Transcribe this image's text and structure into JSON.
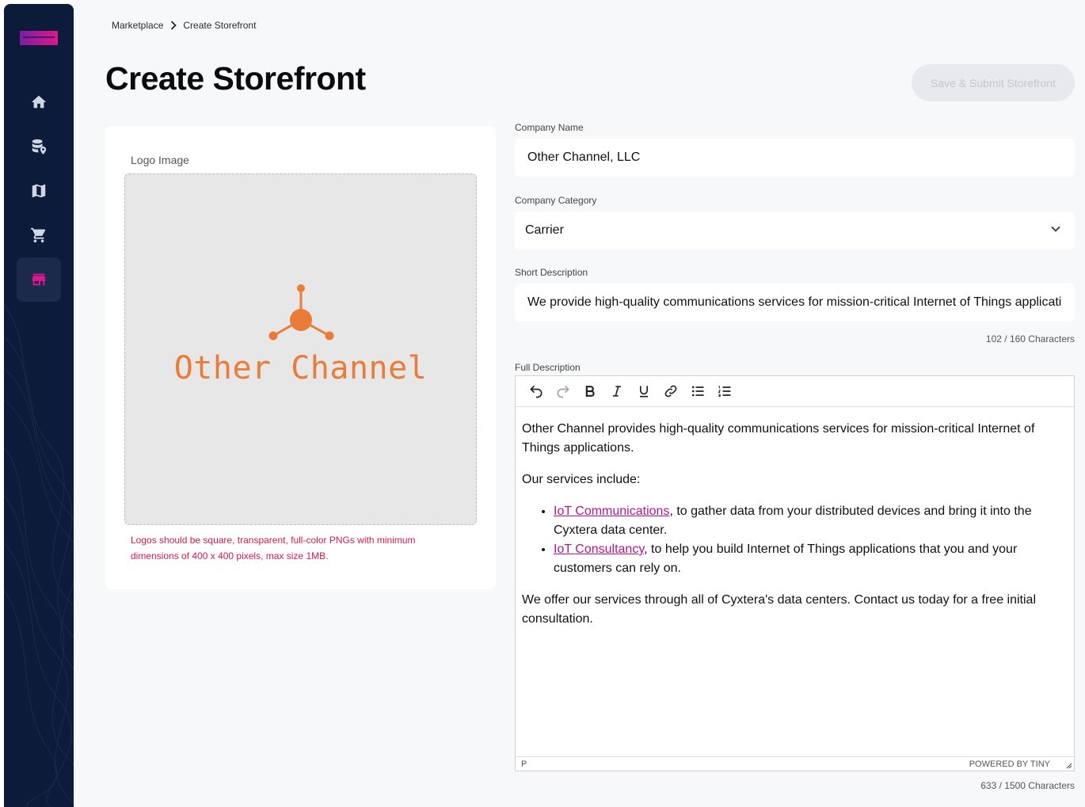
{
  "breadcrumb": {
    "parent": "Marketplace",
    "current": "Create Storefront"
  },
  "page": {
    "title": "Create Storefront",
    "submit_label": "Save & Submit Storefront"
  },
  "sidebar": {
    "items": [
      {
        "icon": "home-icon",
        "active": false
      },
      {
        "icon": "database-pin-icon",
        "active": false
      },
      {
        "icon": "map-icon",
        "active": false
      },
      {
        "icon": "cart-icon",
        "active": false
      },
      {
        "icon": "storefront-icon",
        "active": true
      }
    ]
  },
  "logo": {
    "label": "Logo Image",
    "logo_text": "Other Channel",
    "help": "Logos should be square, transparent, full-color PNGs with minimum dimensions of 400 x 400 pixels, max size 1MB."
  },
  "company_name": {
    "label": "Company Name",
    "value": "Other Channel, LLC"
  },
  "company_category": {
    "label": "Company Category",
    "value": "Carrier"
  },
  "short_description": {
    "label": "Short Description",
    "value": "We provide high-quality communications services for mission-critical Internet of Things applicati",
    "counter": "102 / 160 Characters"
  },
  "full_description": {
    "label": "Full Description",
    "paragraph1": "Other Channel provides high-quality communications services for mission-critical Internet of Things applications.",
    "paragraph2": "Our services include:",
    "item1_link": "IoT Communications",
    "item1_text": ", to gather data from your distributed devices and bring it into the Cyxtera data center.",
    "item2_link": "IoT Consultancy",
    "item2_text": ", to help you build Internet of Things applications that you and your customers can rely on.",
    "paragraph3": "We offer our services through all of Cyxtera's data centers. Contact us today for a free initial consultation.",
    "status_path": "P",
    "powered_by": "POWERED BY TINY",
    "counter": "633 / 1500 Characters"
  },
  "colors": {
    "sidebar": "#0d1b3a",
    "accent": "#e0168d",
    "logo_orange": "#ea7b38",
    "error": "#d11c4f"
  }
}
